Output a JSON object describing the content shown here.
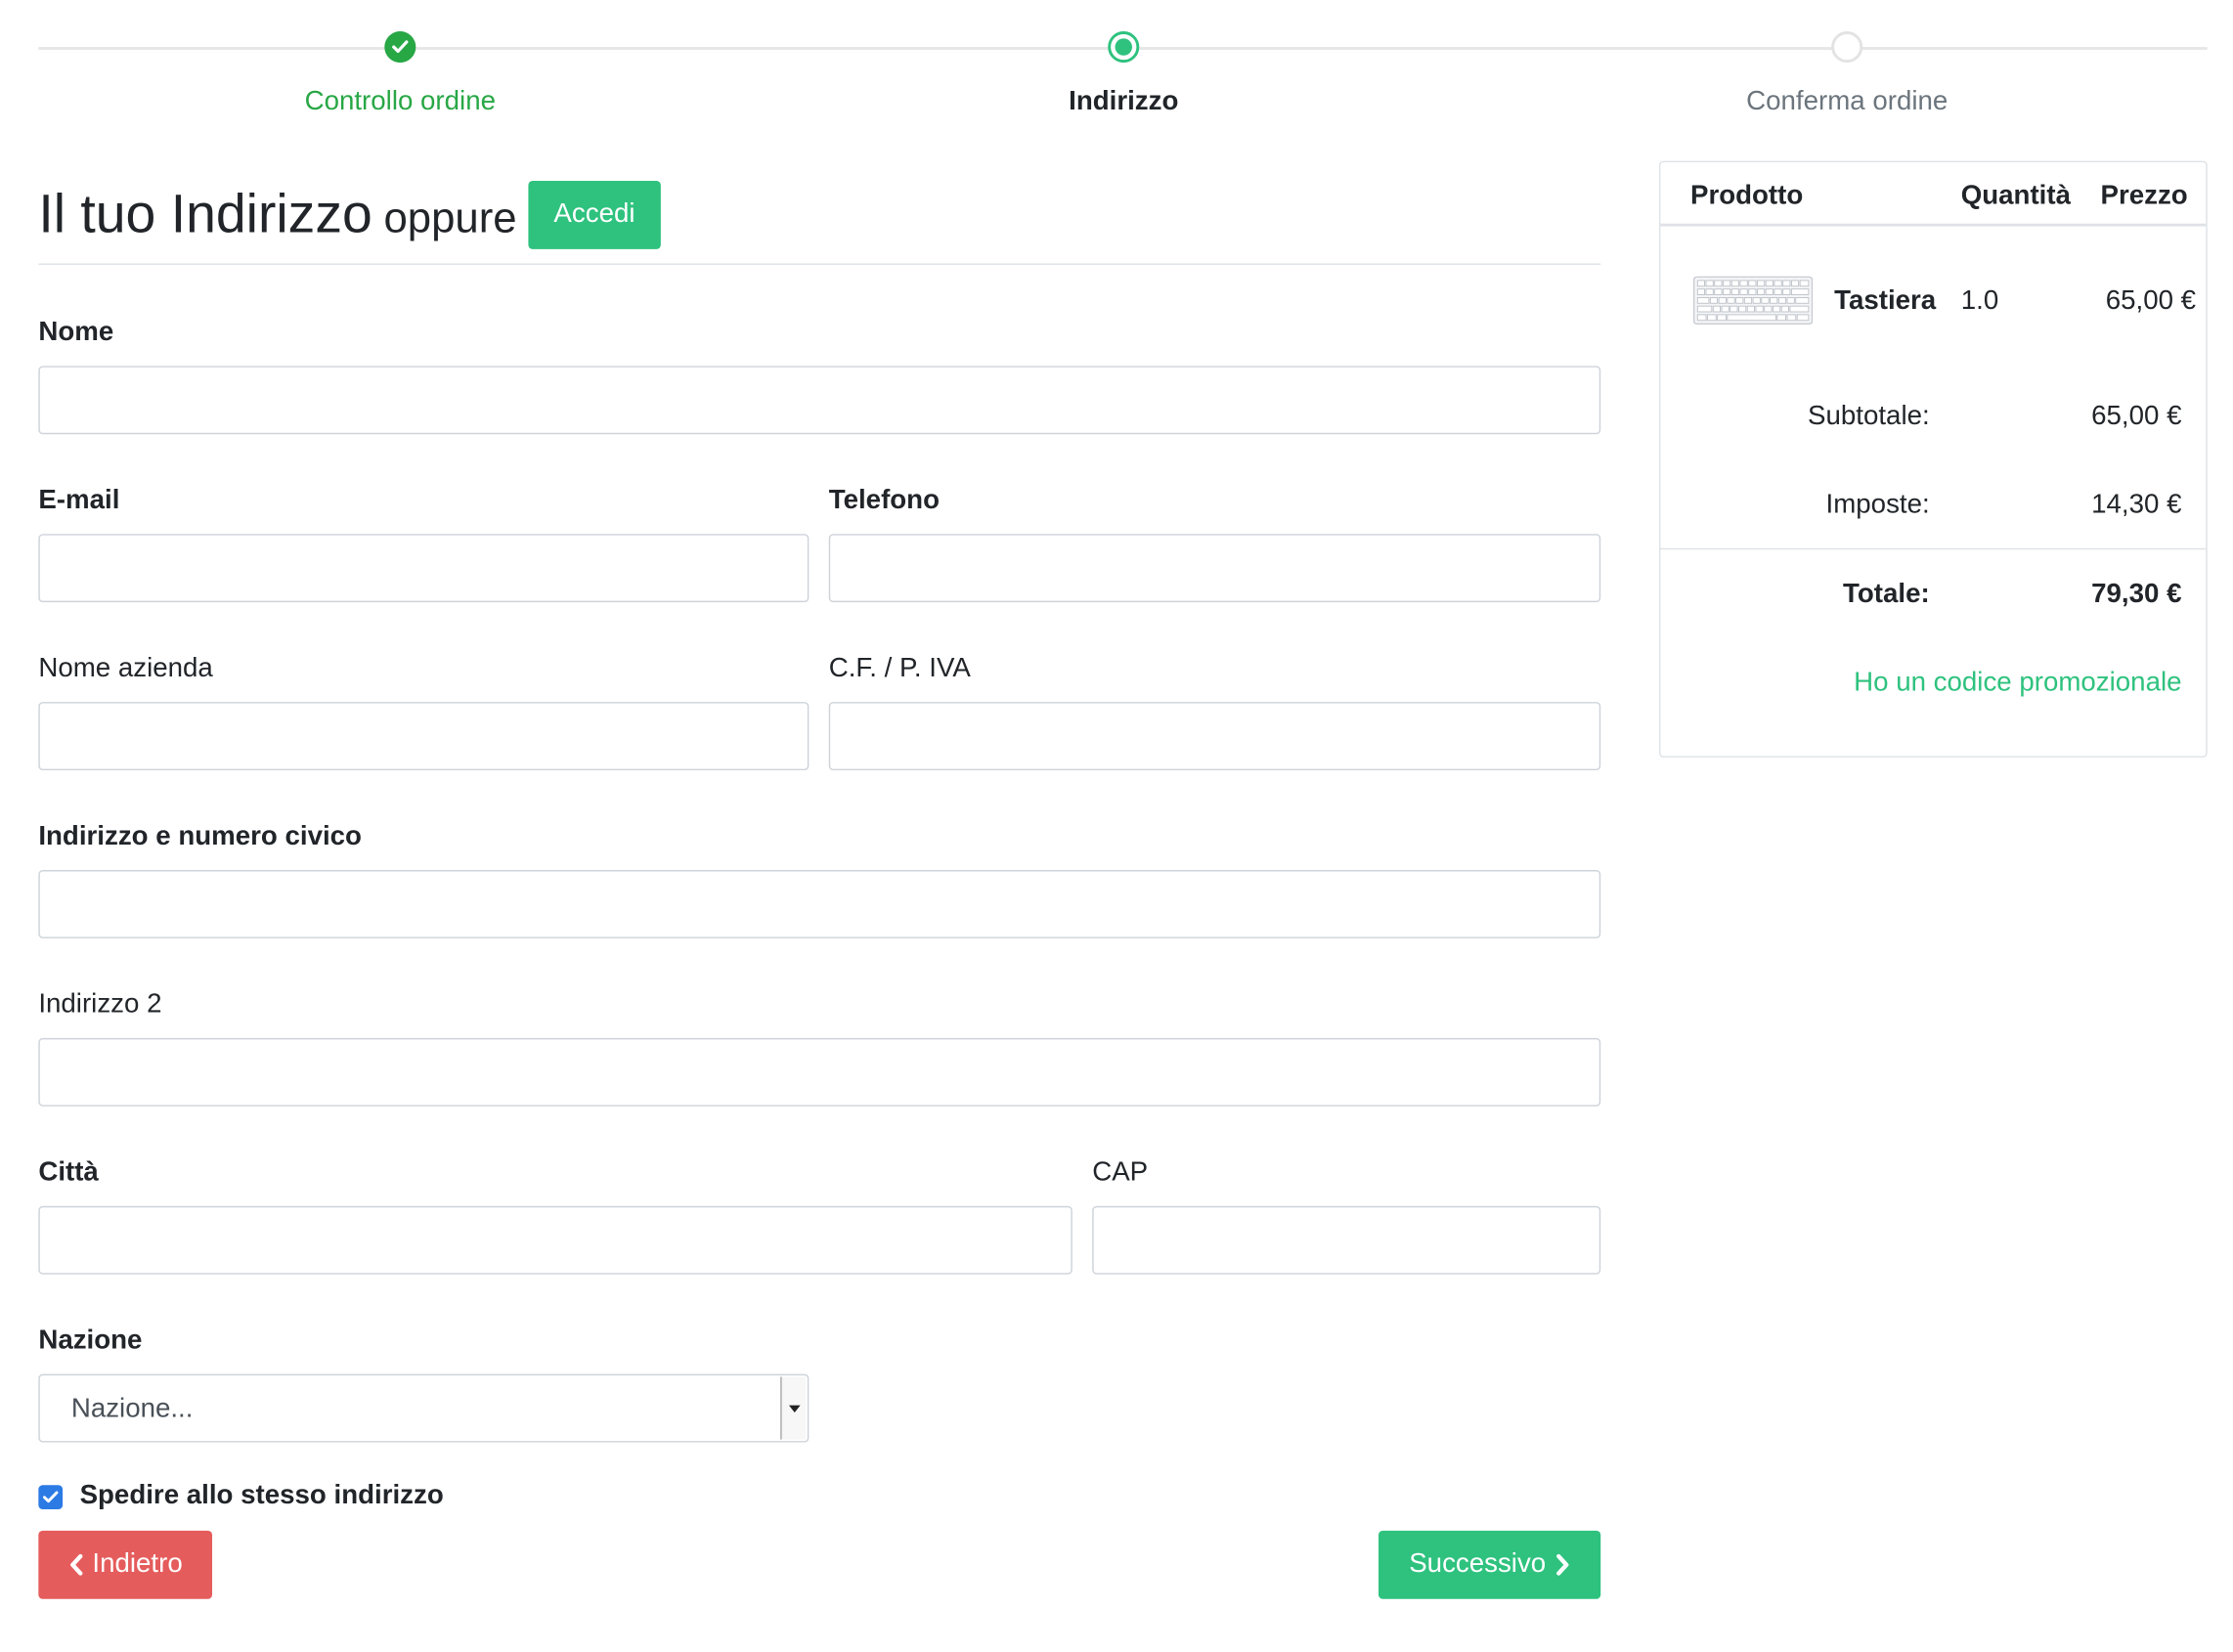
{
  "stepper": {
    "steps": [
      {
        "label": "Controllo ordine",
        "state": "done"
      },
      {
        "label": "Indirizzo",
        "state": "active"
      },
      {
        "label": "Conferma ordine",
        "state": "todo"
      }
    ]
  },
  "heading": {
    "title": "Il tuo Indirizzo",
    "oppure": "oppure",
    "login_button": "Accedi"
  },
  "form": {
    "nome": {
      "label": "Nome",
      "value": ""
    },
    "email": {
      "label": "E-mail",
      "value": ""
    },
    "telefono": {
      "label": "Telefono",
      "value": ""
    },
    "azienda": {
      "label": "Nome azienda",
      "value": ""
    },
    "cf_iva": {
      "label": "C.F. / P. IVA",
      "value": ""
    },
    "indirizzo": {
      "label": "Indirizzo e numero civico",
      "value": ""
    },
    "indirizzo2": {
      "label": "Indirizzo 2",
      "value": ""
    },
    "citta": {
      "label": "Città",
      "value": ""
    },
    "cap": {
      "label": "CAP",
      "value": ""
    },
    "nazione": {
      "label": "Nazione",
      "selected": "Nazione..."
    },
    "stesso_indirizzo": {
      "label": "Spedire allo stesso indirizzo",
      "checked": true
    }
  },
  "buttons": {
    "back": "Indietro",
    "next": "Successivo"
  },
  "cart": {
    "columns": {
      "product": "Prodotto",
      "quantity": "Quantità",
      "price": "Prezzo"
    },
    "items": [
      {
        "name": "Tastiera",
        "quantity": "1.0",
        "price": "65,00 €",
        "thumbnail_icon": "keyboard-icon"
      }
    ],
    "subtotal": {
      "label": "Subtotale:",
      "value": "65,00 €"
    },
    "taxes": {
      "label": "Imposte:",
      "value": "14,30 €"
    },
    "total": {
      "label": "Totale:",
      "value": "79,30 €"
    },
    "promo_link": "Ho un codice promozionale"
  },
  "colors": {
    "accent": "#2ec27e",
    "done": "#28a745",
    "danger": "#e55c5c",
    "checkbox": "#2c7be5"
  }
}
